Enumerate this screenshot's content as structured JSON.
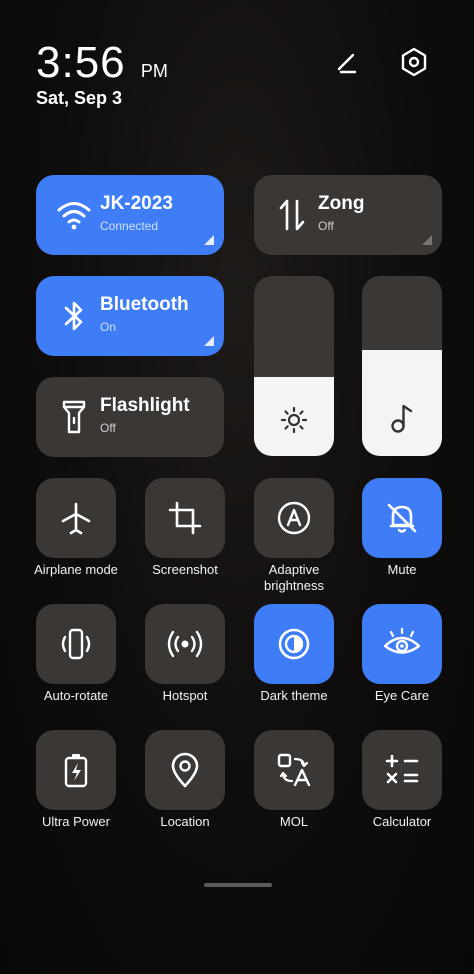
{
  "header": {
    "time": "3:56",
    "ampm": "PM",
    "date": "Sat, Sep 3"
  },
  "header_icons": [
    "edit-icon",
    "settings-hexagon-icon"
  ],
  "big_tiles": {
    "wifi": {
      "title": "JK-2023",
      "status": "Connected"
    },
    "mobile": {
      "title": "Zong",
      "status": "Off"
    },
    "bluetooth": {
      "title": "Bluetooth",
      "status": "On"
    },
    "flashlight": {
      "title": "Flashlight",
      "status": "Off"
    }
  },
  "sliders": {
    "brightness": {
      "level": 0.44
    },
    "volume": {
      "level": 0.59
    }
  },
  "toggles": [
    {
      "label": "Airplane mode",
      "active": false,
      "icon": "airplane-icon"
    },
    {
      "label": "Screenshot",
      "active": false,
      "icon": "crop-icon"
    },
    {
      "label": "Adaptive\nbrightness",
      "active": false,
      "icon": "auto-brightness-icon"
    },
    {
      "label": "Mute",
      "active": true,
      "icon": "bell-off-icon"
    },
    {
      "label": "Auto-rotate",
      "active": false,
      "icon": "rotate-icon"
    },
    {
      "label": "Hotspot",
      "active": false,
      "icon": "hotspot-icon"
    },
    {
      "label": "Dark theme",
      "active": true,
      "icon": "dark-theme-icon"
    },
    {
      "label": "Eye Care",
      "active": true,
      "icon": "eye-icon"
    },
    {
      "label": "Ultra Power",
      "active": false,
      "icon": "battery-bolt-icon"
    },
    {
      "label": "Location",
      "active": false,
      "icon": "location-pin-icon"
    },
    {
      "label": "MOL",
      "active": false,
      "icon": "translate-icon"
    },
    {
      "label": "Calculator",
      "active": false,
      "icon": "calculator-icon"
    }
  ],
  "colors": {
    "accent": "#3f7df7",
    "tile_off": "#3b3734",
    "slider_fill": "#f4f4f4"
  }
}
